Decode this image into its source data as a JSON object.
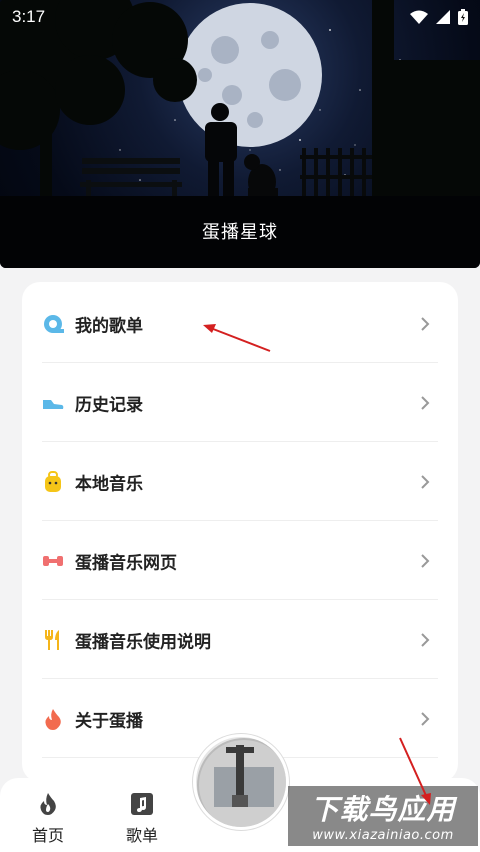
{
  "status_bar": {
    "time": "3:17"
  },
  "header": {
    "title": "蛋播星球"
  },
  "menu": {
    "items": [
      {
        "label": "我的歌单",
        "icon": "playlist-icon",
        "color": "#5bb8e8"
      },
      {
        "label": "历史记录",
        "icon": "shoe-icon",
        "color": "#5bb8e8"
      },
      {
        "label": "本地音乐",
        "icon": "backpack-icon",
        "color": "#f5c518"
      },
      {
        "label": "蛋播音乐网页",
        "icon": "dumbbell-icon",
        "color": "#f07070"
      },
      {
        "label": "蛋播音乐使用说明",
        "icon": "utensils-icon",
        "color": "#f5b51a"
      },
      {
        "label": "关于蛋播",
        "icon": "flame-icon",
        "color": "#f26b4f"
      }
    ]
  },
  "bottom_nav": {
    "home_label": "首页",
    "playlist_label": "歌单"
  },
  "watermark": {
    "main": "下载鸟应用",
    "sub": "www.xiazainiao.com"
  },
  "colors": {
    "accent": "#5bb8e8",
    "annotation_arrow": "#d42020",
    "background": "#f3f3f4"
  }
}
